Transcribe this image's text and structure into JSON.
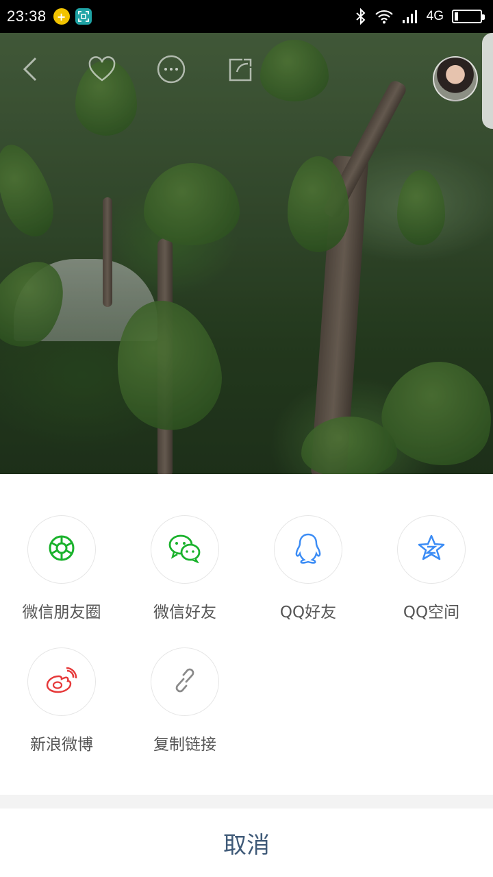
{
  "status_bar": {
    "time": "23:38",
    "network": "4G",
    "battery_level": 0.12,
    "icons": [
      "plus-app-icon",
      "scan-app-icon",
      "bluetooth-icon",
      "wifi-icon",
      "signal-icon",
      "battery-icon"
    ]
  },
  "video_toolbar": {
    "icons": [
      "back-icon",
      "heart-icon",
      "more-icon",
      "share-icon",
      "avatar"
    ]
  },
  "share_sheet": {
    "items": [
      {
        "label": "微信朋友圈",
        "icon": "wechat-moments-icon",
        "color": "#1ab22c"
      },
      {
        "label": "微信好友",
        "icon": "wechat-icon",
        "color": "#1ab22c"
      },
      {
        "label": "QQ好友",
        "icon": "qq-icon",
        "color": "#3b8cf5"
      },
      {
        "label": "QQ空间",
        "icon": "qzone-icon",
        "color": "#3b8cf5"
      },
      {
        "label": "新浪微博",
        "icon": "weibo-icon",
        "color": "#e6393a"
      },
      {
        "label": "复制链接",
        "icon": "link-icon",
        "color": "#8a8a8a"
      }
    ],
    "cancel_label": "取消"
  }
}
